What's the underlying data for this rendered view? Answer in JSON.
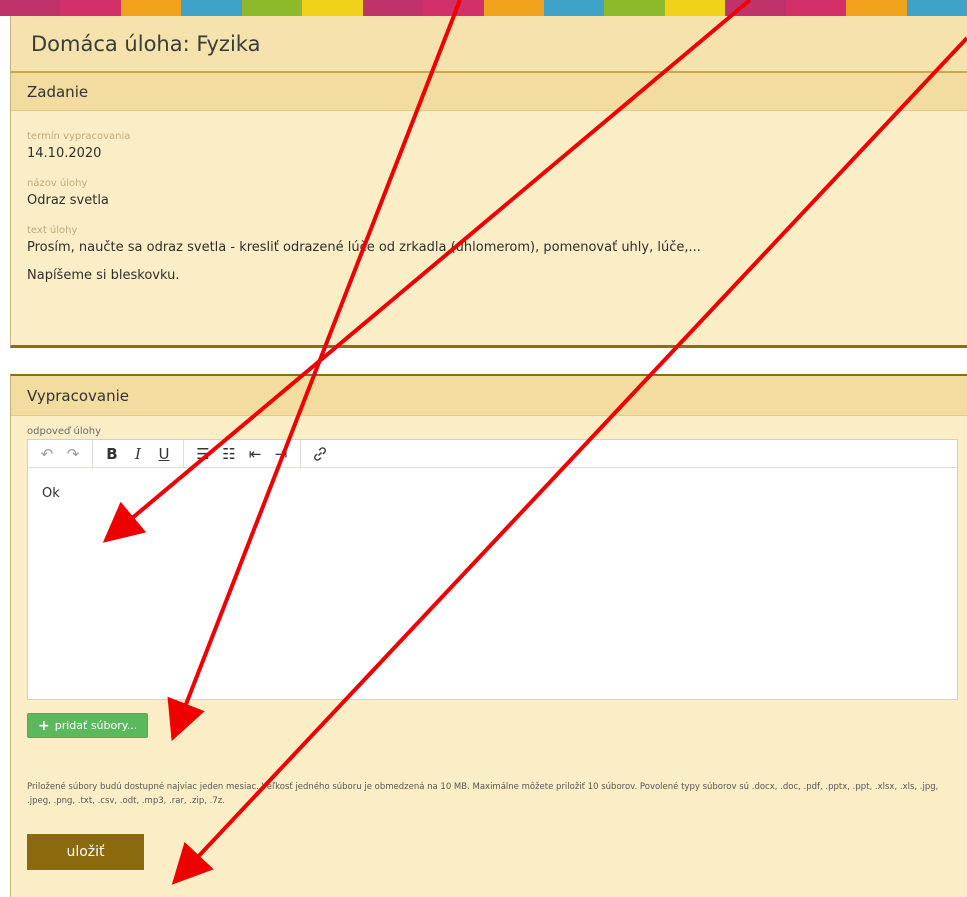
{
  "strip_colors": [
    "#c0336a",
    "#d32f6b",
    "#f0a21d",
    "#3fa3c9",
    "#8dba2a",
    "#f1d21a",
    "#c0336a",
    "#d32f6b",
    "#f0a21d",
    "#3fa3c9",
    "#8dba2a",
    "#f1d21a",
    "#c0336a",
    "#d32f6b",
    "#f0a21d",
    "#3fa3c9"
  ],
  "header": {
    "title": "Domáca úloha: Fyzika"
  },
  "assignment": {
    "section_title": "Zadanie",
    "deadline_label": "termín vypracovania",
    "deadline_value": "14.10.2020",
    "name_label": "názov úlohy",
    "name_value": "Odraz svetla",
    "text_label": "text úlohy",
    "text_line1": "Prosím, naučte sa odraz svetla - kresliť odrazené lúče od zrkadla (uhlomerom), pomenovať uhly, lúče,...",
    "text_line2": "Napíšeme si bleskovku."
  },
  "work": {
    "section_title": "Vypracovanie",
    "editor_label": "odpoveď úlohy",
    "editor_content": "Ok",
    "add_files_label": "pridať súbory...",
    "note": "Priložené súbory budú dostupné najviac jeden mesiac. Veľkosť jedného súboru je obmedzená na 10 MB. Maximálne môžete priložiť 10 súborov. Povolené typy súborov sú .docx, .doc, .pdf, .pptx, .ppt, .xlsx, .xls, .jpg, .jpeg, .png, .txt, .csv, .odt, .mp3, .rar, .zip, .7z.",
    "save_label": "uložiť"
  },
  "toolbar": {
    "undo_icon": "↶",
    "redo_icon": "↷",
    "bold": "B",
    "italic": "I",
    "underline": "U",
    "ul_icon": "☰",
    "ol_icon": "☷",
    "outdent_icon": "⇤",
    "indent_icon": "⇥",
    "link_icon": "🔗"
  },
  "annotation_color": "#ee0000"
}
